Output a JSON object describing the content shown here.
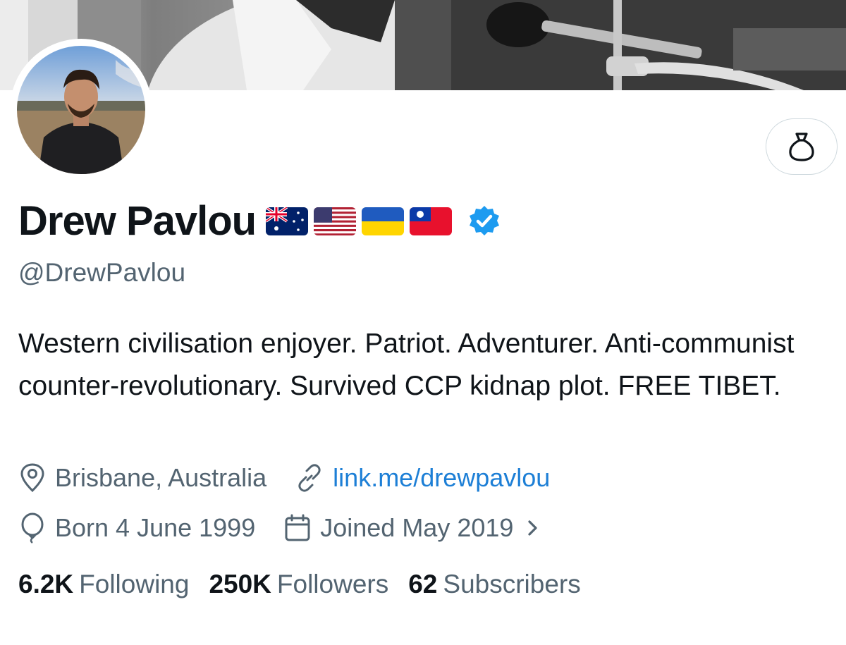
{
  "profile": {
    "name": "Drew Pavlou",
    "handle": "@DrewPavlou",
    "bio": "Western civilisation enjoyer. Patriot. Adventurer. Anti-communist counter-revolutionary. Survived CCP kidnap plot. FREE TIBET.",
    "flags": [
      "australia-flag-icon",
      "usa-flag-icon",
      "ukraine-flag-icon",
      "taiwan-flag-icon"
    ],
    "verified_color": "#1d9bf0"
  },
  "meta": {
    "location": "Brisbane, Australia",
    "link": "link.me/drewpavlou",
    "birthday": "Born 4 June 1999",
    "joined": "Joined May 2019"
  },
  "stats": {
    "following_count": "6.2K",
    "following_label": "Following",
    "followers_count": "250K",
    "followers_label": "Followers",
    "subscribers_count": "62",
    "subscribers_label": "Subscribers"
  },
  "colors": {
    "text_primary": "#0f1419",
    "text_secondary": "#536471",
    "link": "#1d7fd6"
  }
}
